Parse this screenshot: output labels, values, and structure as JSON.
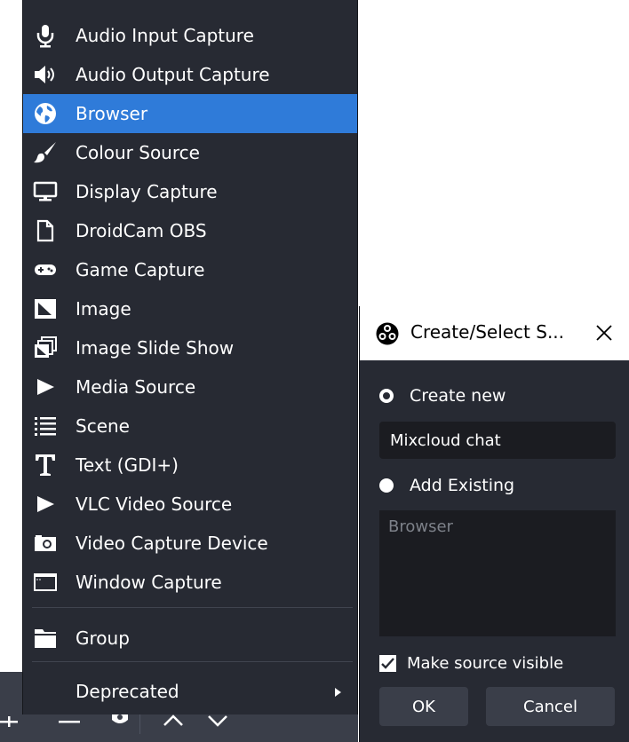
{
  "menu": {
    "items": [
      {
        "label": "Audio Input Capture",
        "icon": "microphone-icon"
      },
      {
        "label": "Audio Output Capture",
        "icon": "speaker-icon"
      },
      {
        "label": "Browser",
        "icon": "globe-icon",
        "selected": true
      },
      {
        "label": "Colour Source",
        "icon": "paintbrush-icon"
      },
      {
        "label": "Display Capture",
        "icon": "monitor-icon"
      },
      {
        "label": "DroidCam OBS",
        "icon": "file-icon"
      },
      {
        "label": "Game Capture",
        "icon": "gamepad-icon"
      },
      {
        "label": "Image",
        "icon": "image-icon"
      },
      {
        "label": "Image Slide Show",
        "icon": "slideshow-icon"
      },
      {
        "label": "Media Source",
        "icon": "play-icon"
      },
      {
        "label": "Scene",
        "icon": "list-icon"
      },
      {
        "label": "Text (GDI+)",
        "icon": "text-icon"
      },
      {
        "label": "VLC Video Source",
        "icon": "play-icon"
      },
      {
        "label": "Video Capture Device",
        "icon": "camera-icon"
      },
      {
        "label": "Window Capture",
        "icon": "window-icon"
      }
    ],
    "group_label": "Group",
    "deprecated_label": "Deprecated"
  },
  "toolbar": {
    "icons": [
      "add-icon",
      "remove-icon",
      "gear-icon",
      "move-up-icon",
      "move-down-icon"
    ]
  },
  "dialog": {
    "title": "Create/Select S...",
    "create_new_label": "Create new",
    "name_value": "Mixcloud chat",
    "add_existing_label": "Add Existing",
    "existing_sources": [
      "Browser"
    ],
    "make_visible_label": "Make source visible",
    "make_visible_checked": true,
    "ok_label": "OK",
    "cancel_label": "Cancel"
  },
  "colors": {
    "menu_bg": "#272a33",
    "selection": "#2f7bd9",
    "toolbar_bg": "#3a3e49",
    "field_bg": "#1b1c21"
  }
}
